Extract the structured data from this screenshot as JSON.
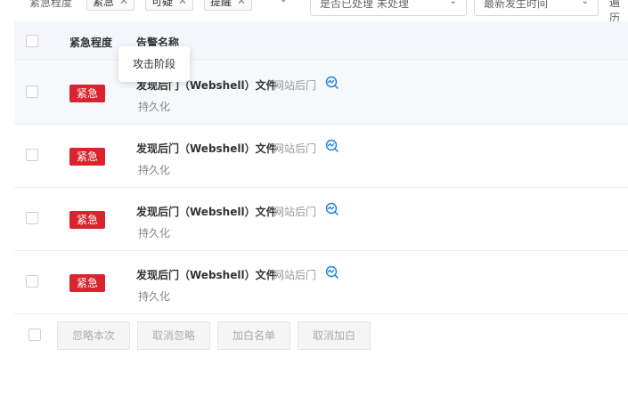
{
  "filters": {
    "urgency_label": "紧急程度",
    "urgency_tags": [
      {
        "label": "紧急"
      },
      {
        "label": "可疑"
      },
      {
        "label": "提醒"
      }
    ],
    "status_select": "是否已处理   未处理",
    "sort_select": "最新发生时间",
    "overflow_text": "遍历"
  },
  "table": {
    "columns": {
      "urgency": "紧急程度",
      "alarm_name": "告警名称"
    },
    "rows": [
      {
        "urgency": "紧急",
        "alarm": "发现后门（Webshell）文件",
        "category": "网站后门",
        "stage": "持久化"
      },
      {
        "urgency": "紧急",
        "alarm": "发现后门（Webshell）文件",
        "category": "网站后门",
        "stage": "持久化"
      },
      {
        "urgency": "紧急",
        "alarm": "发现后门（Webshell）文件",
        "category": "网站后门",
        "stage": "持久化"
      },
      {
        "urgency": "紧急",
        "alarm": "发现后门（Webshell）文件",
        "category": "网站后门",
        "stage": "持久化"
      }
    ]
  },
  "tooltip": {
    "text": "攻击阶段"
  },
  "actions": {
    "ignore_once": "忽略本次",
    "cancel_ignore": "取消忽略",
    "add_whitelist": "加白名单",
    "cancel_whitelist": "取消加白"
  },
  "colors": {
    "urgent_badge": "#d9232e",
    "link_icon": "#1f7de0",
    "header_bg": "#f4f6fb"
  },
  "icons": {
    "row_action": "trend-search-icon",
    "tag_close": "close-icon",
    "dropdown": "chevron-down-icon"
  }
}
